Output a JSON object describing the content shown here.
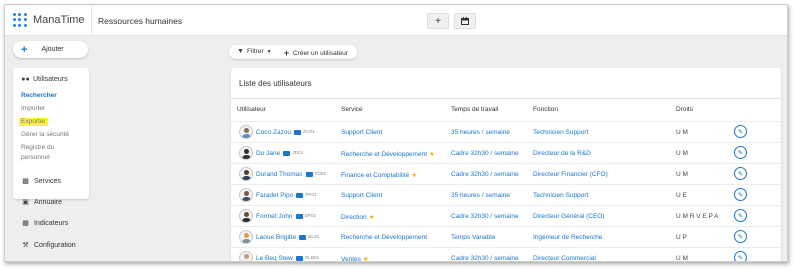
{
  "app": {
    "logo_text": "ManaTime",
    "page_title": "Ressources humaines"
  },
  "header": {
    "add_icon": "+",
    "calendar_icon": "calendar-icon"
  },
  "sidebar": {
    "add_label": "Ajouter",
    "section_title": "Utilisateurs",
    "sub_items": [
      "Rechercher",
      "Importer",
      "Exporter",
      "Gérer la sécurité",
      "Registre du",
      "personnel"
    ],
    "nav": [
      "Services",
      "Annuaire",
      "Indicateurs",
      "Configuration"
    ]
  },
  "toolbar": {
    "filter_label": "Filtrer",
    "create_label": "Créer un utilisateur"
  },
  "table": {
    "title": "Liste des utilisateurs",
    "columns": [
      "Utilisateur",
      "Service",
      "Temps de travail",
      "Fonction",
      "Droits"
    ],
    "rows": [
      {
        "name": "Coco Zazou",
        "code": "ZC01",
        "service": "Support Client",
        "star": "",
        "time": "35 heures / semaine",
        "role": "Technicien Support",
        "rights": "U M"
      },
      {
        "name": "Do Jane",
        "code": "JD01",
        "service": "Recherche et Développement",
        "star": "★",
        "time": "Cadre 32h30 / semaine",
        "role": "Directeur de la R&D",
        "rights": "U M"
      },
      {
        "name": "Durand Thomas",
        "code": "TD01",
        "service": "Finance et Comptabilité",
        "star": "★",
        "time": "Cadre 32h30 / semaine",
        "role": "Directeur Financier (CFO)",
        "rights": "U M"
      },
      {
        "name": "Faradet Pipo",
        "code": "PF01",
        "service": "Support Client",
        "star": "",
        "time": "35 heures / semaine",
        "role": "Technicien Support",
        "rights": "U E"
      },
      {
        "name": "Formet John",
        "code": "DF01",
        "service": "Direction",
        "star": "★",
        "time": "Cadre 32h30 / semaine",
        "role": "Directeur Général (CEO)",
        "rights": "U M R V E P A"
      },
      {
        "name": "Laoue Brigitte",
        "code": "BL01",
        "service": "Recherche et Développement",
        "star": "",
        "time": "Temps Variable",
        "role": "Ingénieur de Recherche",
        "rights": "U P"
      },
      {
        "name": "Le Beq Stew",
        "code": "SLB01",
        "service": "Ventes",
        "star": "★",
        "time": "Cadre 32h30 / semaine",
        "role": "Directeur Commercial",
        "rights": "U M"
      }
    ]
  },
  "colors": {
    "accent": "#1976d2",
    "highlight": "#fff33a",
    "star": "#f5b400"
  }
}
